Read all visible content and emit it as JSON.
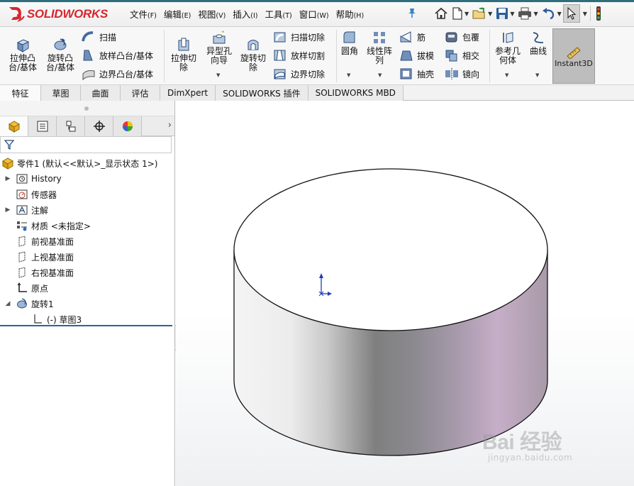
{
  "app": {
    "logo_text": "SOLIDWORKS",
    "brand_color": "#d7262e"
  },
  "menu": {
    "items": [
      {
        "label": "文件",
        "accel": "(F)"
      },
      {
        "label": "编辑",
        "accel": "(E)"
      },
      {
        "label": "视图",
        "accel": "(V)"
      },
      {
        "label": "插入",
        "accel": "(I)"
      },
      {
        "label": "工具",
        "accel": "(T)"
      },
      {
        "label": "窗口",
        "accel": "(W)"
      },
      {
        "label": "帮助",
        "accel": "(H)"
      }
    ]
  },
  "quick_access": {
    "icons": [
      "home-icon",
      "new-document-icon",
      "open-folder-icon",
      "save-icon",
      "print-icon",
      "undo-icon",
      "select-cursor-icon",
      "options-icon"
    ]
  },
  "ribbon": {
    "extruded_boss": "拉伸凸\n台/基体",
    "revolved_boss": "旋转凸\n台/基体",
    "sweep": "扫描",
    "loft": "放样凸台/基体",
    "boundary": "边界凸台/基体",
    "extruded_cut": "拉伸切\n除",
    "hole_wizard": "异型孔\n向导",
    "revolved_cut": "旋转切\n除",
    "swept_cut": "扫描切除",
    "lofted_cut": "放样切割",
    "boundary_cut": "边界切除",
    "fillet": "圆角",
    "linear_pattern": "线性阵\n列",
    "rib": "筋",
    "draft": "拔模",
    "shell": "抽壳",
    "wrap": "包覆",
    "intersect": "相交",
    "mirror": "镜向",
    "reference_geometry": "参考几\n何体",
    "curves": "曲线",
    "instant3d": "Instant3D"
  },
  "tabs": [
    {
      "label": "特征",
      "active": true
    },
    {
      "label": "草图",
      "active": false
    },
    {
      "label": "曲面",
      "active": false
    },
    {
      "label": "评估",
      "active": false
    },
    {
      "label": "DimXpert",
      "active": false
    },
    {
      "label": "SOLIDWORKS 插件",
      "active": false
    },
    {
      "label": "SOLIDWORKS MBD",
      "active": false
    }
  ],
  "feature_tree": {
    "part": "零件1  (默认<<默认>_显示状态 1>)",
    "history": "History",
    "sensors": "传感器",
    "annotations": "注解",
    "material": "材质 <未指定>",
    "front_plane": "前视基准面",
    "top_plane": "上视基准面",
    "right_plane": "右视基准面",
    "origin": "原点",
    "revolve1": "旋转1",
    "sketch3": "(-) 草图3"
  },
  "watermark": {
    "main": "Bai 经验",
    "sub": "jingyan.baidu.com"
  },
  "colors": {
    "accent": "#2f5f9f",
    "instant3d_bg": "#bdbdbd",
    "model_outline": "#111111"
  }
}
